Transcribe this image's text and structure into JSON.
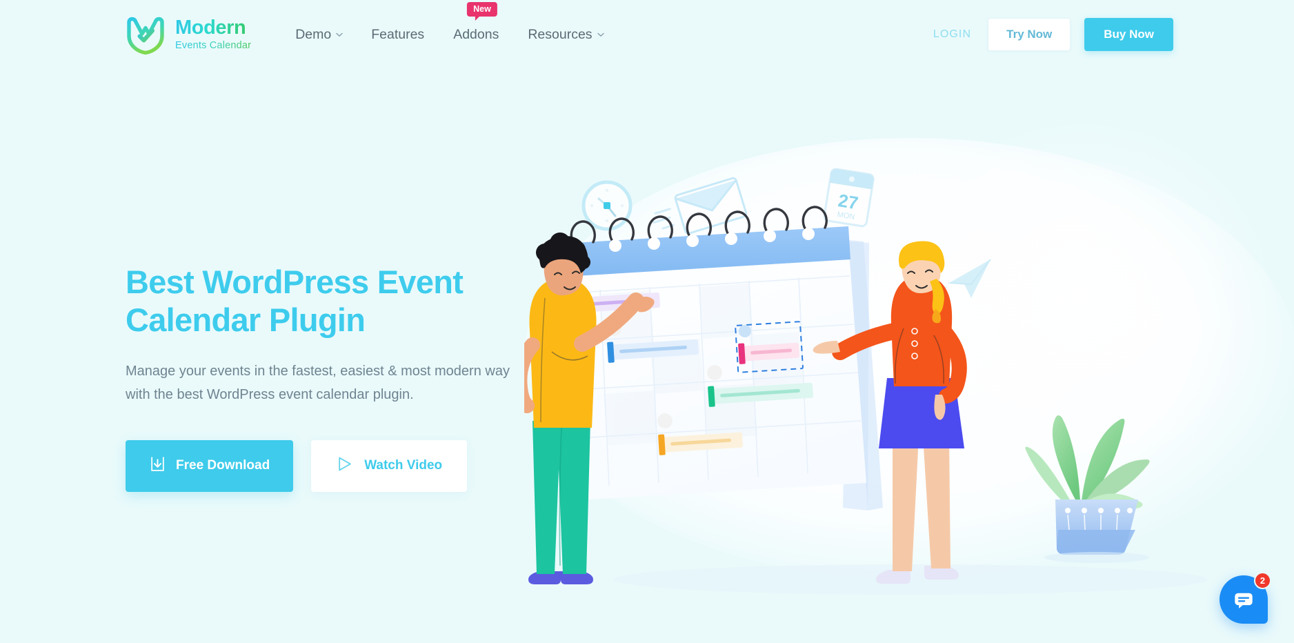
{
  "brand": {
    "title": "Modern",
    "subtitle": "Events Calendar",
    "logo_icon": "shield-check-icon",
    "gradient_from": "#2ec8e6",
    "gradient_to": "#35c95f"
  },
  "nav": {
    "items": [
      {
        "label": "Demo",
        "has_dropdown": true,
        "badge": ""
      },
      {
        "label": "Features",
        "has_dropdown": false,
        "badge": ""
      },
      {
        "label": "Addons",
        "has_dropdown": false,
        "badge": "New"
      },
      {
        "label": "Resources",
        "has_dropdown": true,
        "badge": ""
      }
    ],
    "badge_color": "#e8336d"
  },
  "header_actions": {
    "login_label": "LOGIN",
    "try_label": "Try Now",
    "buy_label": "Buy Now",
    "accent": "#3fcbeb"
  },
  "hero": {
    "title_line1": "Best WordPress Event",
    "title_line2": "Calendar Plugin",
    "subtitle": "Manage your events in the fastest, easiest & most modern way with the best WordPress event calendar plugin.",
    "primary_cta": "Free Download",
    "primary_icon": "download-icon",
    "secondary_cta": "Watch Video",
    "secondary_icon": "play-icon",
    "title_color": "#3ecced",
    "subtitle_color": "#6e8490"
  },
  "illustration": {
    "calendar_day_number": "27",
    "calendar_day_label": "MON",
    "icons": [
      "clock-icon",
      "envelope-icon",
      "calendar-page-icon",
      "paper-plane-icon",
      "phone-call-icon"
    ],
    "event_bar_colors": [
      "#9b5de5",
      "#2f8fe0",
      "#e8337e",
      "#19c38a",
      "#f5a623"
    ],
    "calendar_header_color": "#8cc0f5",
    "people": [
      "person-left-pointing",
      "person-right-pointing"
    ],
    "plant": "potted-plant"
  },
  "chat_widget": {
    "icon": "chat-bubble-icon",
    "unread_count": "2",
    "color": "#1a8cf5",
    "badge_color": "#f0382b"
  }
}
